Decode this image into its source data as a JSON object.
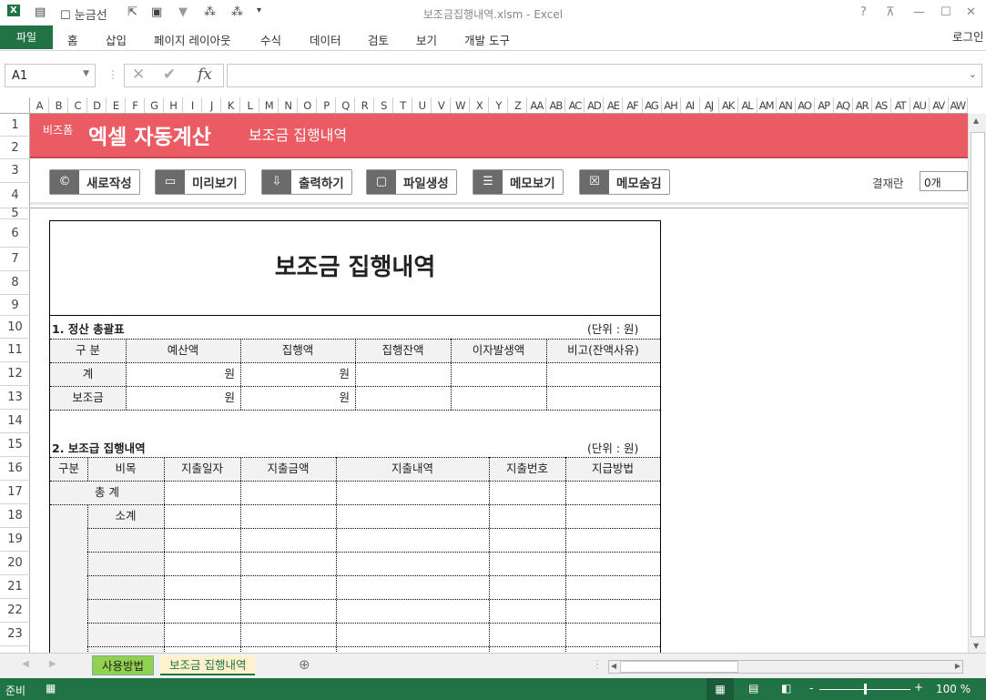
{
  "window": {
    "title": "보조금집행내역.xlsm - Excel",
    "help": "?",
    "login": "로그인"
  },
  "quick_access": {
    "gridlines_label": "눈금선"
  },
  "ribbon": {
    "tabs": [
      "파일",
      "홈",
      "삽입",
      "페이지 레이아웃",
      "수식",
      "데이터",
      "검토",
      "보기",
      "개발 도구"
    ]
  },
  "formula_bar": {
    "name_box": "A1",
    "fx": "fx",
    "value": ""
  },
  "columns": [
    "A",
    "B",
    "C",
    "D",
    "E",
    "F",
    "G",
    "H",
    "I",
    "J",
    "K",
    "L",
    "M",
    "N",
    "O",
    "P",
    "Q",
    "R",
    "S",
    "T",
    "U",
    "V",
    "W",
    "X",
    "Y",
    "Z",
    "AA",
    "AB",
    "AC",
    "AD",
    "AE",
    "AF",
    "AG",
    "AH",
    "AI",
    "AJ",
    "AK",
    "AL",
    "AM",
    "AN",
    "AO",
    "AP",
    "AQ",
    "AR",
    "AS",
    "AT",
    "AU",
    "AV",
    "AW"
  ],
  "rows": [
    "1",
    "2",
    "3",
    "4",
    "5",
    "6",
    "7",
    "8",
    "9",
    "10",
    "11",
    "12",
    "13",
    "14",
    "15",
    "16",
    "17",
    "18",
    "19",
    "20",
    "21",
    "22",
    "23"
  ],
  "banner": {
    "brand_small": "비즈폼",
    "brand_big": "엑셀 자동계산",
    "subtitle": "보조금 집행내역"
  },
  "toolbar": {
    "buttons": [
      "새로작성",
      "미리보기",
      "출력하기",
      "파일생성",
      "메모보기",
      "메모숨김"
    ],
    "approval_label": "결재란",
    "approval_value": "0개"
  },
  "document": {
    "title": "보조금 집행내역",
    "section1": {
      "title": "1. 정산 총괄표",
      "unit": "(단위 : 원)",
      "headers": [
        "구 분",
        "예산액",
        "집행액",
        "집행잔액",
        "이자발생액",
        "비고(잔액사유)"
      ],
      "rows": [
        [
          "계",
          "원",
          "원",
          "",
          "",
          ""
        ],
        [
          "보조금",
          "원",
          "원",
          "",
          "",
          ""
        ]
      ]
    },
    "section2": {
      "title": "2. 보조급 집행내역",
      "unit": "(단위 : 원)",
      "headers": [
        "구분",
        "비목",
        "지출일자",
        "지출금액",
        "지출내역",
        "지출번호",
        "지급방법"
      ],
      "total_label": "총 계",
      "subtotal_label": "소계"
    }
  },
  "sheet_tabs": [
    "사용방법",
    "보조금 집행내역"
  ],
  "status": {
    "ready": "준비",
    "zoom": "100 %",
    "zoom_fraction": 1.0
  }
}
